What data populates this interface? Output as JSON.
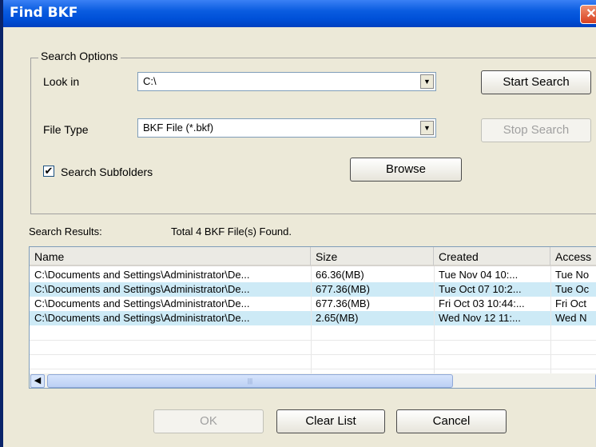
{
  "window": {
    "title": "Find BKF"
  },
  "search_options": {
    "legend": "Search Options",
    "look_in_label": "Look in",
    "look_in_value": "C:\\",
    "file_type_label": "File Type",
    "file_type_value": "BKF File (*.bkf)",
    "subfolders_label": "Search Subfolders",
    "subfolders_checked": true
  },
  "buttons": {
    "start_search": "Start Search",
    "stop_search": "Stop Search",
    "browse": "Browse",
    "ok": "OK",
    "clear_list": "Clear List",
    "cancel": "Cancel"
  },
  "results": {
    "label": "Search Results:",
    "summary": "Total 4 BKF File(s) Found.",
    "columns": [
      "Name",
      "Size",
      "Created",
      "Access"
    ],
    "rows": [
      {
        "name": "C:\\Documents and Settings\\Administrator\\De...",
        "size": "66.36(MB)",
        "created": "Tue Nov 04 10:...",
        "accessed": "Tue No"
      },
      {
        "name": "C:\\Documents and Settings\\Administrator\\De...",
        "size": "677.36(MB)",
        "created": "Tue Oct 07 10:2...",
        "accessed": "Tue Oc"
      },
      {
        "name": "C:\\Documents and Settings\\Administrator\\De...",
        "size": "677.36(MB)",
        "created": "Fri Oct 03 10:44:...",
        "accessed": "Fri Oct"
      },
      {
        "name": "C:\\Documents and Settings\\Administrator\\De...",
        "size": "2.65(MB)",
        "created": "Wed Nov 12 11:...",
        "accessed": "Wed N"
      }
    ]
  }
}
